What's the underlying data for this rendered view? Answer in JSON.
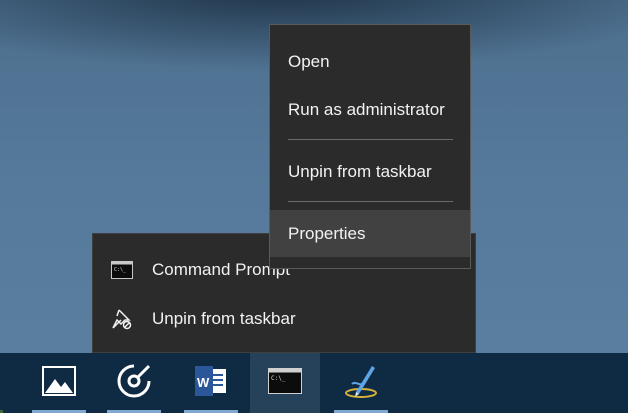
{
  "context_menu": {
    "items": [
      {
        "label": "Open"
      },
      {
        "label": "Run as administrator"
      },
      {
        "label": "Unpin from taskbar"
      },
      {
        "label": "Properties"
      }
    ]
  },
  "jump_list": {
    "items": [
      {
        "label": "Command Prompt",
        "icon": "command-prompt-icon"
      },
      {
        "label": "Unpin from taskbar",
        "icon": "unpin-icon"
      }
    ]
  },
  "taskbar": {
    "apps": [
      {
        "name": "photos",
        "icon": "photos-icon"
      },
      {
        "name": "groove-music",
        "icon": "groove-music-icon"
      },
      {
        "name": "word",
        "icon": "word-icon"
      },
      {
        "name": "command-prompt",
        "icon": "command-prompt-icon",
        "active": true
      },
      {
        "name": "editor",
        "icon": "pen-icon"
      }
    ],
    "accent_color": "#7fa7cf",
    "background_color": "#0f2b43"
  }
}
